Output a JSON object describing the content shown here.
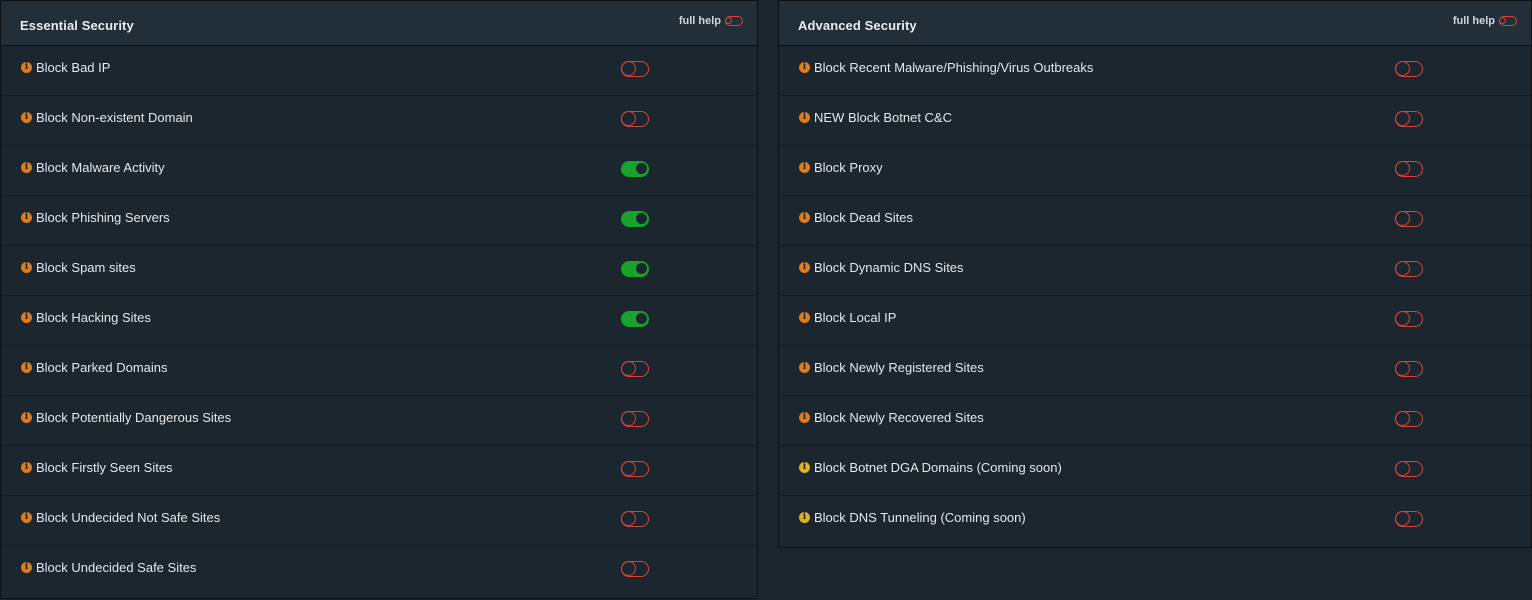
{
  "colors": {
    "toggle_off": "#d9443a",
    "toggle_on": "#17a32c",
    "info_icon": "#e07b20",
    "info_icon_soon": "#e0b020"
  },
  "essential": {
    "title": "Essential Security",
    "full_help_label": "full help",
    "full_help_on": false,
    "items": [
      {
        "label": "Block Bad IP",
        "enabled": false
      },
      {
        "label": "Block Non-existent Domain",
        "enabled": false
      },
      {
        "label": "Block Malware Activity",
        "enabled": true
      },
      {
        "label": "Block Phishing Servers",
        "enabled": true
      },
      {
        "label": "Block Spam sites",
        "enabled": true
      },
      {
        "label": "Block Hacking Sites",
        "enabled": true
      },
      {
        "label": "Block Parked Domains",
        "enabled": false
      },
      {
        "label": "Block Potentially Dangerous Sites",
        "enabled": false
      },
      {
        "label": "Block Firstly Seen Sites",
        "enabled": false
      },
      {
        "label": "Block Undecided Not Safe Sites",
        "enabled": false
      },
      {
        "label": "Block Undecided Safe Sites",
        "enabled": false
      }
    ]
  },
  "advanced": {
    "title": "Advanced Security",
    "full_help_label": "full help",
    "full_help_on": false,
    "items": [
      {
        "label": "Block Recent Malware/Phishing/Virus Outbreaks",
        "enabled": false,
        "coming_soon": false
      },
      {
        "label": "NEW Block Botnet C&C",
        "enabled": false,
        "coming_soon": false
      },
      {
        "label": "Block Proxy",
        "enabled": false,
        "coming_soon": false
      },
      {
        "label": "Block Dead Sites",
        "enabled": false,
        "coming_soon": false
      },
      {
        "label": "Block Dynamic DNS Sites",
        "enabled": false,
        "coming_soon": false
      },
      {
        "label": "Block Local IP",
        "enabled": false,
        "coming_soon": false
      },
      {
        "label": "Block Newly Registered Sites",
        "enabled": false,
        "coming_soon": false
      },
      {
        "label": "Block Newly Recovered Sites",
        "enabled": false,
        "coming_soon": false
      },
      {
        "label": "Block Botnet DGA Domains (Coming soon)",
        "enabled": false,
        "coming_soon": true
      },
      {
        "label": "Block DNS Tunneling (Coming soon)",
        "enabled": false,
        "coming_soon": true
      }
    ]
  }
}
